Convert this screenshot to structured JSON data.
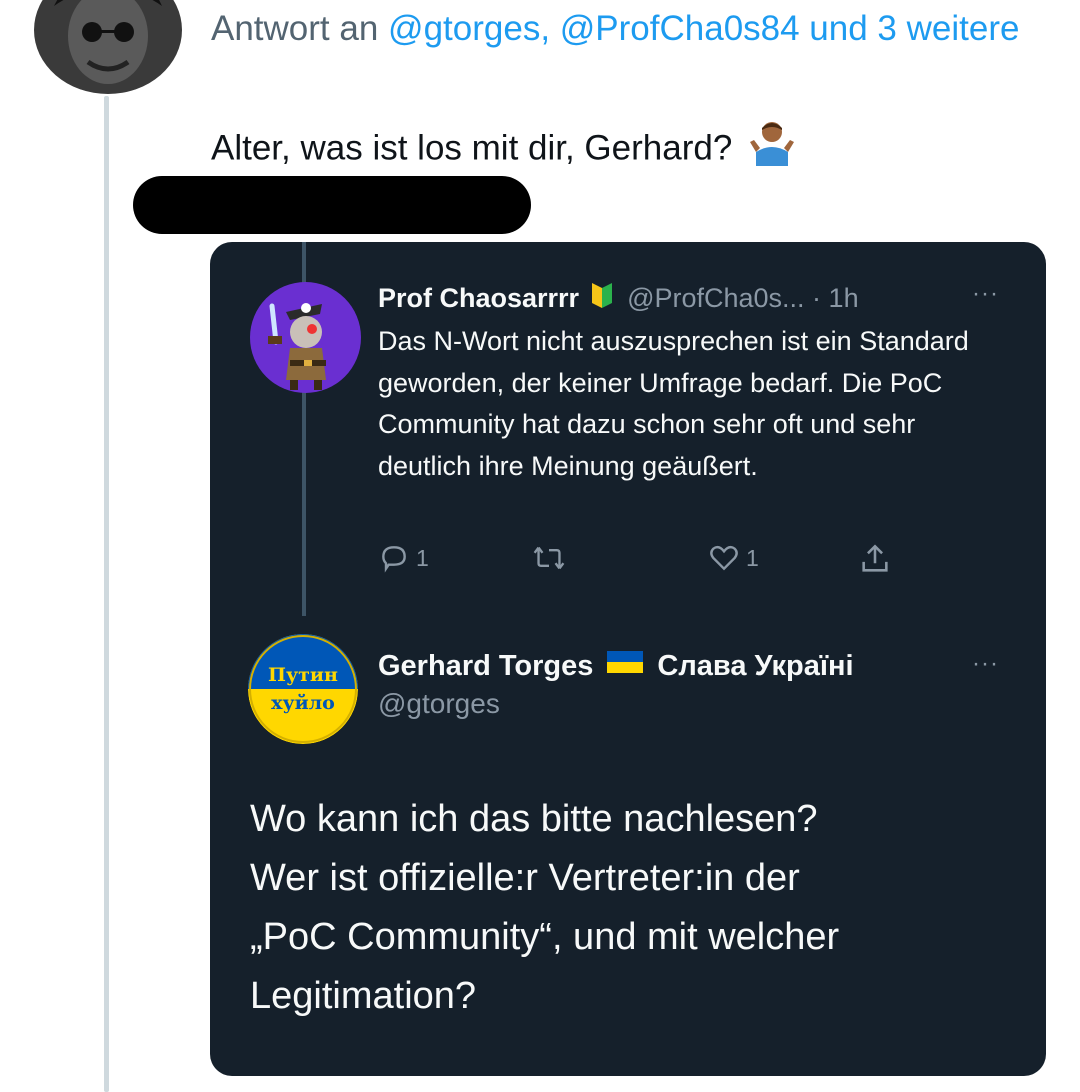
{
  "reply": {
    "prefix": "Antwort an",
    "mentions": "@gtorges, @ProfCha0s84 und 3 weitere",
    "text": "Alter, was ist los mit dir, Gerhard?",
    "emoji_icon": "person-shrugging-icon"
  },
  "quoted": {
    "name": "Prof Chaosarrrr",
    "badge_icon": "beginner-badge-icon",
    "handle_time": "@ProfCha0s... · 1h",
    "more": "···",
    "text": "Das N-Wort nicht auszusprechen ist ein Standard geworden, der keiner Umfrage bedarf. Die PoC Community hat dazu schon sehr oft und sehr deutlich ihre Meinung geäußert.",
    "actions": {
      "reply_count": "1",
      "retweet_count": "",
      "like_count": "1"
    }
  },
  "main": {
    "name": "Gerhard Torges",
    "flag_icon": "ukraine-flag-icon",
    "name_suffix": "Слава Україні",
    "handle": "@gtorges",
    "more": "···",
    "avatar_text_line1": "Путин",
    "avatar_text_line2": "хуйло",
    "text_line1": "Wo kann ich das bitte nachlesen?",
    "text_line2": "Wer ist offizielle:r Vertreter:in der",
    "text_line3": "„PoC Community“, und mit welcher",
    "text_line4": "Legitimation?"
  },
  "colors": {
    "card_bg": "#15202b",
    "link_blue": "#1d9bf0",
    "muted": "#8b98a5",
    "ukraine_blue": "#0057b7",
    "ukraine_yellow": "#ffd700"
  }
}
